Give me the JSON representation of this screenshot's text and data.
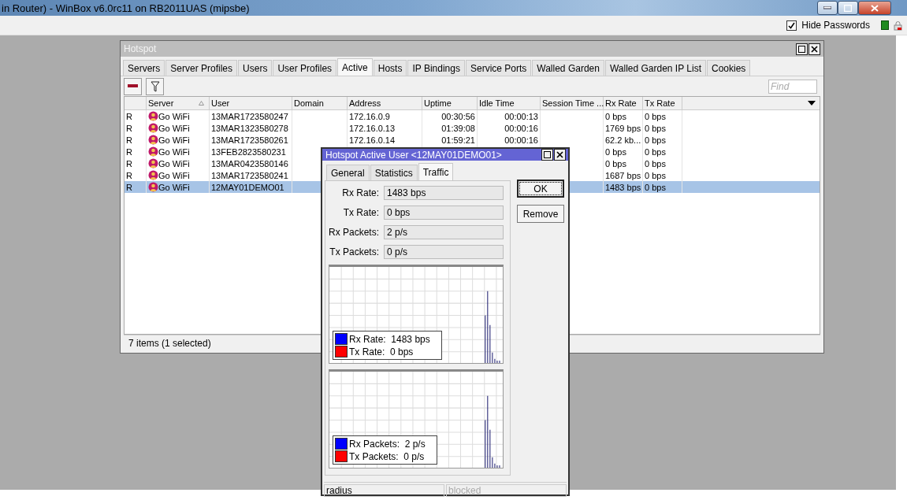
{
  "app_window": {
    "title": "in Router) - WinBox v6.0rc11 on RB2011UAS (mipsbe)"
  },
  "toolbar": {
    "hide_passwords": {
      "label": "Hide Passwords",
      "checked": true
    }
  },
  "hotspot": {
    "title": "Hotspot",
    "tabs": [
      {
        "label": "Servers",
        "selected": false
      },
      {
        "label": "Server Profiles",
        "selected": false
      },
      {
        "label": "Users",
        "selected": false
      },
      {
        "label": "User Profiles",
        "selected": false
      },
      {
        "label": "Active",
        "selected": true
      },
      {
        "label": "Hosts",
        "selected": false
      },
      {
        "label": "IP Bindings",
        "selected": false
      },
      {
        "label": "Service Ports",
        "selected": false
      },
      {
        "label": "Walled Garden",
        "selected": false
      },
      {
        "label": "Walled Garden IP List",
        "selected": false
      },
      {
        "label": "Cookies",
        "selected": false
      }
    ],
    "find": {
      "placeholder": "Find"
    },
    "columns": [
      {
        "label": "Server",
        "sorted": true
      },
      {
        "label": "User",
        "sorted": false
      },
      {
        "label": "Domain",
        "sorted": false
      },
      {
        "label": "Address",
        "sorted": false
      },
      {
        "label": "Uptime",
        "sorted": false
      },
      {
        "label": "Idle Time",
        "sorted": false
      },
      {
        "label": "Session Time ...",
        "sorted": false
      },
      {
        "label": "Rx Rate",
        "sorted": false
      },
      {
        "label": "Tx Rate",
        "sorted": false
      }
    ],
    "rows": [
      {
        "flag": "R",
        "server": "Go WiFi",
        "user": "13MAR1723580247",
        "address": "172.16.0.9",
        "uptime": "00:30:56",
        "idle_time": "00:00:13",
        "rx_rate": "0 bps",
        "tx_rate": "0 bps",
        "selected": false
      },
      {
        "flag": "R",
        "server": "Go WiFi",
        "user": "13MAR1323580278",
        "address": "172.16.0.13",
        "uptime": "01:39:08",
        "idle_time": "00:00:16",
        "rx_rate": "1769 bps",
        "tx_rate": "0 bps",
        "selected": false
      },
      {
        "flag": "R",
        "server": "Go WiFi",
        "user": "13MAR1723580261",
        "address": "172.16.0.14",
        "uptime": "01:59:21",
        "idle_time": "00:00:16",
        "rx_rate": "62.2 kb...",
        "tx_rate": "0 bps",
        "selected": false
      },
      {
        "flag": "R",
        "server": "Go WiFi",
        "user": "13FEB2823580231",
        "rx_rate": "0 bps",
        "tx_rate": "0 bps",
        "selected": false
      },
      {
        "flag": "R",
        "server": "Go WiFi",
        "user": "13MAR0423580146",
        "rx_rate": "0 bps",
        "tx_rate": "0 bps",
        "selected": false
      },
      {
        "flag": "R",
        "server": "Go WiFi",
        "user": "13MAR1723580241",
        "rx_rate": "1687 bps",
        "tx_rate": "0 bps",
        "selected": false
      },
      {
        "flag": "R",
        "server": "Go WiFi",
        "user": "12MAY01DEMO01",
        "rx_rate": "1483 bps",
        "tx_rate": "0 bps",
        "selected": true
      }
    ],
    "status": "7 items (1 selected)"
  },
  "dialog": {
    "title": "Hotspot Active User <12MAY01DEMO01>",
    "tabs": [
      {
        "label": "General",
        "selected": false
      },
      {
        "label": "Statistics",
        "selected": false
      },
      {
        "label": "Traffic",
        "selected": true
      }
    ],
    "fields": [
      {
        "label": "Rx Rate:",
        "value": "1483 bps"
      },
      {
        "label": "Tx Rate:",
        "value": "0 bps"
      },
      {
        "label": "Rx Packets:",
        "value": "2 p/s"
      },
      {
        "label": "Tx Packets:",
        "value": "0 p/s"
      }
    ],
    "graphs": [
      {
        "legend": [
          {
            "label": "Rx Rate:  1483 bps",
            "color": "#0000ff"
          },
          {
            "label": "Tx Rate:  0 bps",
            "color": "#ff0000"
          }
        ]
      },
      {
        "legend": [
          {
            "label": "Rx Packets:  2 p/s",
            "color": "#0000ff"
          },
          {
            "label": "Tx Packets:  0 p/s",
            "color": "#ff0000"
          }
        ]
      }
    ],
    "buttons": [
      "OK",
      "Remove"
    ],
    "status": [
      {
        "text": "radius",
        "disabled": false
      },
      {
        "text": "blocked",
        "disabled": true
      }
    ]
  }
}
